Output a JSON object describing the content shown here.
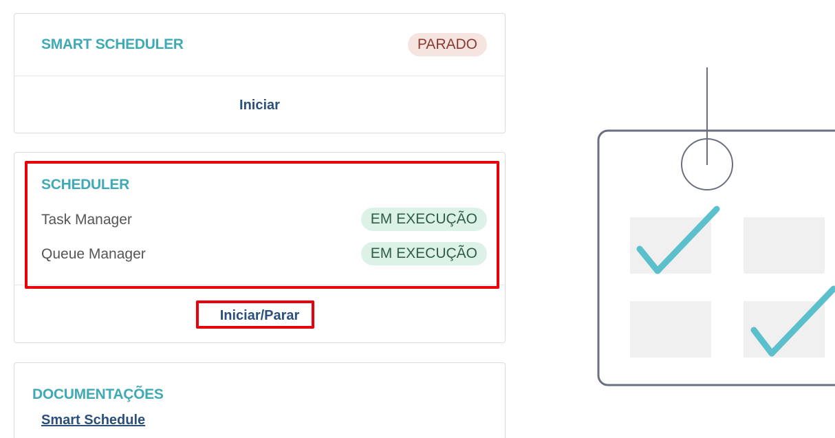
{
  "colors": {
    "title": "#3fa9b5",
    "action": "#2a4f7a",
    "stopped_bg": "#f6e4e1",
    "stopped_text": "#8a3a32",
    "running_bg": "#dcf2e6",
    "running_text": "#2f5d45",
    "highlight": "#e8000b",
    "check": "#5bc0cb"
  },
  "smart_scheduler": {
    "title": "SMART SCHEDULER",
    "status": "PARADO",
    "action": "Iniciar"
  },
  "scheduler": {
    "title": "SCHEDULER",
    "rows": [
      {
        "label": "Task Manager",
        "status": "EM EXECUÇÃO"
      },
      {
        "label": "Queue Manager",
        "status": "EM EXECUÇÃO"
      }
    ],
    "action": "Iniciar/Parar"
  },
  "docs": {
    "title": "DOCUMENTAÇÕES",
    "link": "Smart Schedule"
  },
  "illustration": {
    "icon": "calendar-checklist-icon"
  }
}
